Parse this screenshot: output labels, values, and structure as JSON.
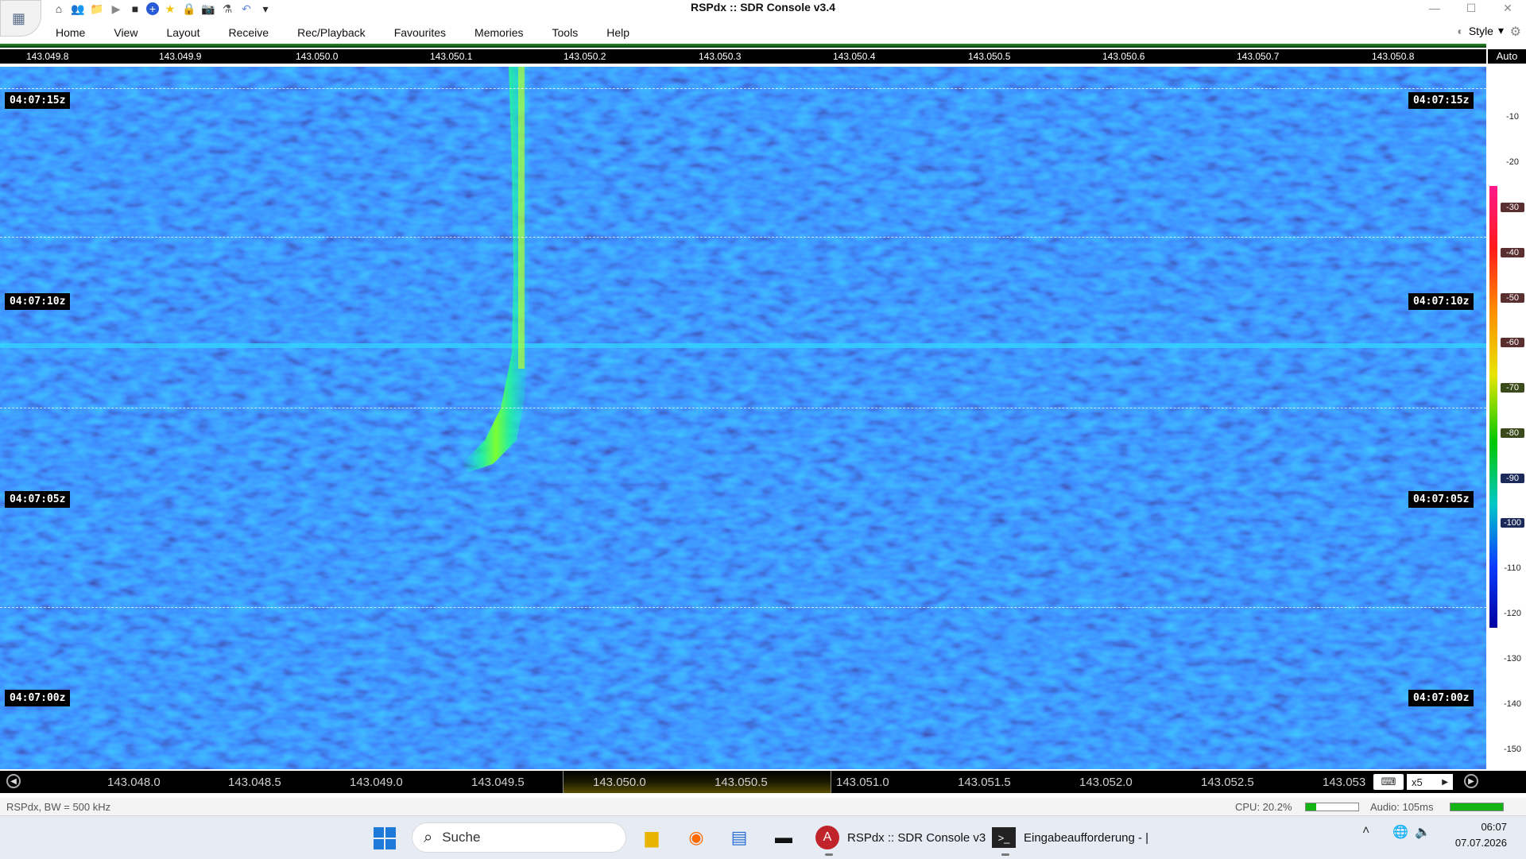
{
  "window": {
    "title": "RSPdx :: SDR Console v3.4",
    "minimize": "—",
    "maximize": "☐",
    "close": "✕"
  },
  "qat": [
    {
      "name": "home-icon",
      "glyph": "⌂"
    },
    {
      "name": "users-icon",
      "glyph": "👥"
    },
    {
      "name": "folder-icon",
      "glyph": "📁"
    },
    {
      "name": "play-icon",
      "glyph": "▶"
    },
    {
      "name": "stop-icon",
      "glyph": "■"
    },
    {
      "name": "plus-icon",
      "glyph": "+"
    },
    {
      "name": "star-icon",
      "glyph": "★"
    },
    {
      "name": "lock-icon",
      "glyph": "🔒"
    },
    {
      "name": "camera-icon",
      "glyph": "📷"
    },
    {
      "name": "flask-icon",
      "glyph": "⚗"
    },
    {
      "name": "undo-icon",
      "glyph": "↶"
    },
    {
      "name": "dropdown-icon",
      "glyph": "▾"
    }
  ],
  "menu": [
    "Home",
    "View",
    "Layout",
    "Receive",
    "Rec/Playback",
    "Favourites",
    "Memories",
    "Tools",
    "Help"
  ],
  "style_menu": {
    "label": "Style",
    "arrow": "▾"
  },
  "top_scale": [
    "143.049.8",
    "143.049.9",
    "143.050.0",
    "143.050.1",
    "143.050.2",
    "143.050.3",
    "143.050.4",
    "143.050.5",
    "143.050.6",
    "143.050.7",
    "143.050.8"
  ],
  "auto_label": "Auto",
  "time_marks": [
    "04:07:15z",
    "04:07:10z",
    "04:07:05z",
    "04:07:00z"
  ],
  "db_scale": [
    "-10",
    "-20",
    "-30",
    "-40",
    "-50",
    "-60",
    "-70",
    "-80",
    "-90",
    "-100",
    "-110",
    "-120",
    "-130",
    "-140",
    "-150"
  ],
  "bottom_scale": [
    "143.048.0",
    "143.048.5",
    "143.049.0",
    "143.049.5",
    "143.050.0",
    "143.050.5",
    "143.051.0",
    "143.051.5",
    "143.052.0",
    "143.052.5",
    "143.053"
  ],
  "zoom": {
    "value": "x5",
    "arrow": "▶"
  },
  "status": {
    "device": "RSPdx, BW = 500 kHz",
    "cpu": "CPU: 20.2%",
    "cpu_level": 0.202,
    "audio": "Audio: 105ms",
    "audio_level": 1.0
  },
  "taskbar": {
    "search_placeholder": "Suche",
    "apps": [
      {
        "label": "RSPdx :: SDR Console v3",
        "icon": "sdr-console-icon"
      },
      {
        "label": "Eingabeaufforderung - |",
        "icon": "command-prompt-icon"
      }
    ],
    "time": "06:07",
    "date": "07.07.2026"
  },
  "colors": {
    "waterfall_bg": "#0b2fb6",
    "signal": "#3cff3c",
    "carrier": "#3ce0ff"
  }
}
